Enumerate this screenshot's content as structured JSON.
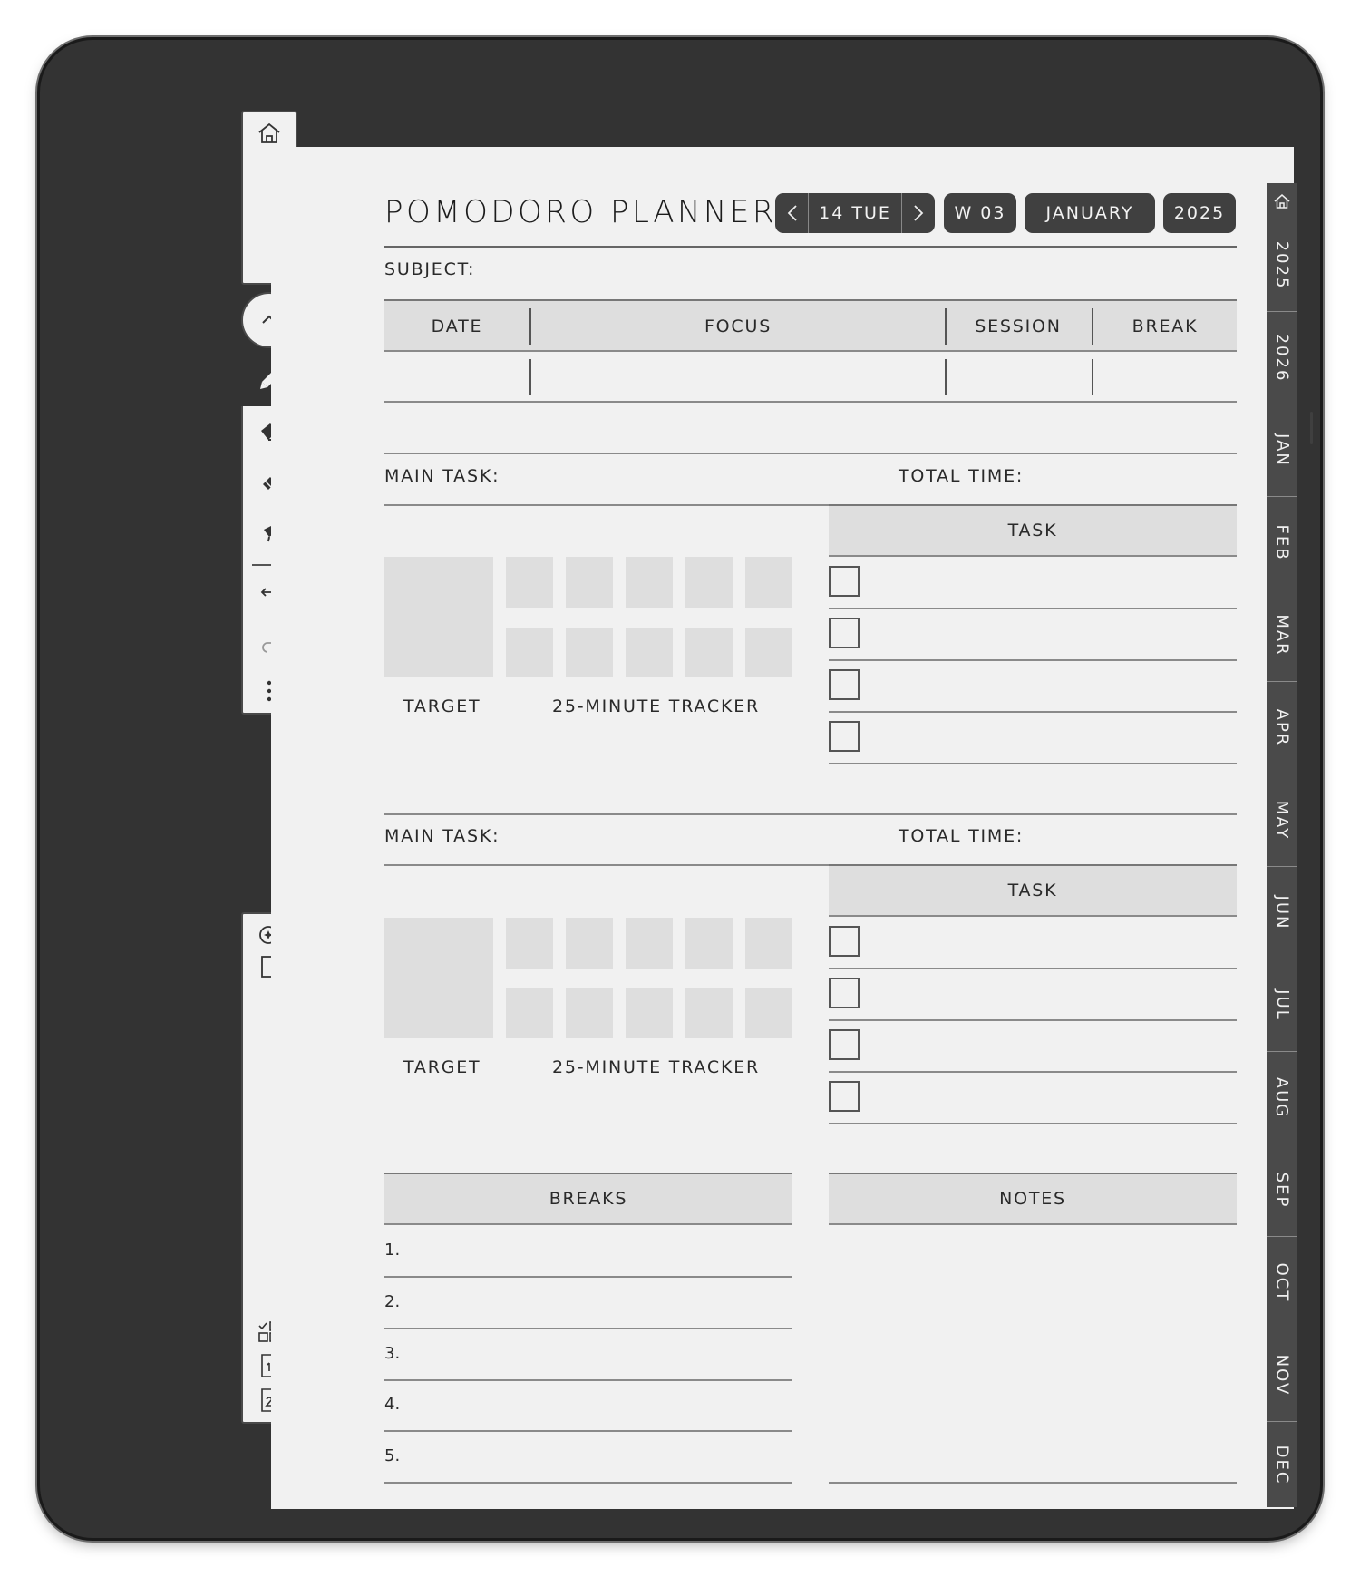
{
  "header": {
    "title": "POMODORO PLANNER",
    "date_label": "14 TUE",
    "week_label": "W 03",
    "month_label": "JANUARY",
    "year_label": "2025"
  },
  "subject": {
    "label": "SUBJECT:",
    "columns": [
      "DATE",
      "FOCUS",
      "SESSION",
      "BREAK"
    ]
  },
  "sections": [
    {
      "main_task_label": "MAIN TASK:",
      "total_time_label": "TOTAL TIME:",
      "task_header": "TASK",
      "target_label": "TARGET",
      "tracker_label": "25-MINUTE TRACKER"
    },
    {
      "main_task_label": "MAIN TASK:",
      "total_time_label": "TOTAL TIME:",
      "task_header": "TASK",
      "target_label": "TARGET",
      "tracker_label": "25-MINUTE TRACKER"
    }
  ],
  "breaks": {
    "header": "BREAKS",
    "items": [
      "1.",
      "2.",
      "3.",
      "4.",
      "5."
    ]
  },
  "notes": {
    "header": "NOTES"
  },
  "side_tabs": [
    "2025",
    "2026",
    "JAN",
    "FEB",
    "MAR",
    "APR",
    "MAY",
    "JUN",
    "JUL",
    "AUG",
    "SEP",
    "OCT",
    "NOV",
    "DEC"
  ],
  "toolbar": {
    "icons": [
      "home-icon",
      "chevron-up-icon",
      "pen-icon",
      "marker-icon",
      "eraser-icon",
      "highlighter-icon",
      "undo-icon",
      "redo-icon",
      "more-icon",
      "ai-sparkle-icon",
      "page-icon",
      "layout-grid-icon",
      "page-1-icon",
      "page-2-icon"
    ]
  }
}
